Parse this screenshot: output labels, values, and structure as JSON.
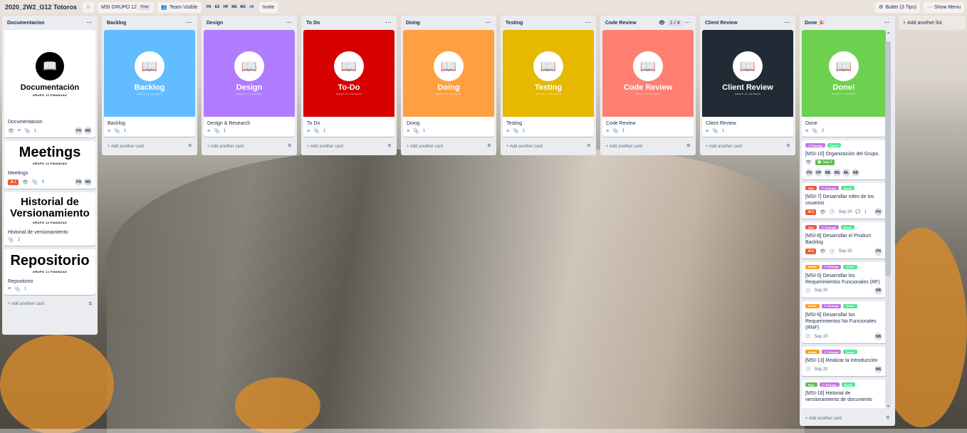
{
  "header": {
    "board_title": "2020_2W2_G12 Totoros",
    "star_icon": "star-icon",
    "team_label": "MSI GRUPO 12",
    "free_label": "Free",
    "visibility_label": "Team Visible",
    "members": [
      "FN",
      "ES",
      "HP",
      "ME",
      "MS"
    ],
    "more_members": "+5",
    "invite_label": "Invite",
    "butler_label": "Butler (3 Tips)",
    "show_menu_label": "Show Menu"
  },
  "lists": [
    {
      "title": "Documentacion"
    },
    {
      "title": "Backlog",
      "cover_title": "Backlog",
      "cover_color": "#61bdff",
      "card_title": "Backlog",
      "add": "Add another card"
    },
    {
      "title": "Design",
      "cover_title": "Design",
      "cover_color": "#b07cff",
      "card_title": "Design & Research",
      "add": "Add another card"
    },
    {
      "title": "To Do",
      "cover_title": "To-Do",
      "cover_color": "#d60000",
      "card_title": "To Do",
      "add": "Add another card"
    },
    {
      "title": "Doing",
      "cover_title": "Doing",
      "cover_color": "#ff9f40",
      "card_title": "Doing",
      "add": "Add another card"
    },
    {
      "title": "Testing",
      "cover_title": "Testing",
      "cover_color": "#e6b800",
      "card_title": "Testing",
      "add": "Add another card"
    },
    {
      "title": "Code Review",
      "limit": "1 / 4",
      "cover_title": "Code Review",
      "cover_color": "#ff7f73",
      "card_title": "Code Review",
      "add": "Add another card"
    },
    {
      "title": "Client Review",
      "cover_title": "Client Review",
      "cover_color": "#222b35",
      "card_title": "Client Review",
      "add": "Add another card"
    },
    {
      "title": "Done 🎉",
      "cover_title": "Done!",
      "cover_color": "#6dd04f",
      "card_title": "Done",
      "attach_count": "2",
      "add": "Add another card"
    }
  ],
  "doc": {
    "card1_cover": "Documentación",
    "card1_sub": "GRUPO 12 FINANZAS",
    "card1_title": "Documentacion",
    "card1_attach": "1",
    "card2_cover": "Meetings",
    "card2_sub": "GRUPO 12 FINANZAS",
    "card2_title": "Meetings",
    "card2_red": "1",
    "card2_attach": "5",
    "card3_cover_a": "Historial de",
    "card3_cover_b": "Versionamiento",
    "card3_sub": "GRUPO 12 FINANZAS",
    "card3_title": "Historial de versionamiento",
    "card3_attach": "2",
    "card4_cover": "Repositorio",
    "card4_sub": "GRUPO 12 FINANZAS",
    "card4_title": "Repositorio",
    "card4_attach": "1",
    "add": "Add another card",
    "members": [
      "FN",
      "MS"
    ]
  },
  "cover_sub": "GRUPO 12 FINANZAS",
  "done_cards": [
    {
      "labels": [
        {
          "t": "1° Entrega",
          "c": "#c377e0"
        },
        {
          "t": "Donel",
          "c": "#51e898"
        }
      ],
      "title": "[MSI-10] Organización del Grupo.",
      "due": "Sep 5",
      "members": [
        "FN",
        "HP",
        "ME",
        "MS",
        "ML",
        "NB"
      ]
    },
    {
      "labels": [
        {
          "t": "Alto",
          "c": "#eb5a46"
        },
        {
          "t": "1° Entrega",
          "c": "#c377e0"
        },
        {
          "t": "Donel",
          "c": "#51e898"
        }
      ],
      "title": "[MSI-7] Desarrollar roles de los usuarios",
      "red": "5",
      "date": "Sep 20",
      "comments": "1",
      "members": [
        "FN"
      ]
    },
    {
      "labels": [
        {
          "t": "Alto",
          "c": "#eb5a46"
        },
        {
          "t": "1° Entrega",
          "c": "#c377e0"
        },
        {
          "t": "Donel",
          "c": "#51e898"
        }
      ],
      "title": "[MSI-8] Desarrollar el Product Backlog",
      "red": "6",
      "date": "Sep 20",
      "members": [
        "FN"
      ]
    },
    {
      "labels": [
        {
          "t": "Medio",
          "c": "#ff9f1a"
        },
        {
          "t": "1° Entrega",
          "c": "#c377e0"
        },
        {
          "t": "Donel",
          "c": "#51e898"
        }
      ],
      "title": "[MSI-5] Desarrollar los Requerimientos Funcionales (RF)",
      "date": "Sep 20",
      "members": [
        "NB"
      ]
    },
    {
      "labels": [
        {
          "t": "Medio",
          "c": "#ff9f1a"
        },
        {
          "t": "1° Entrega",
          "c": "#c377e0"
        },
        {
          "t": "Donel",
          "c": "#51e898"
        }
      ],
      "title": "[MSI-6] Desarrollar los Requerimientos No Funcionales (RNF)",
      "date": "Sep 20",
      "members": [
        "NB"
      ]
    },
    {
      "labels": [
        {
          "t": "Medio",
          "c": "#ff9f1a"
        },
        {
          "t": "1° Entrega",
          "c": "#c377e0"
        },
        {
          "t": "Donel",
          "c": "#51e898"
        }
      ],
      "title": "[MSI-13] Realizar la Introducción",
      "date": "Sep 20",
      "members": [
        "MS"
      ]
    },
    {
      "labels": [
        {
          "t": "Bajo",
          "c": "#61bd4f"
        },
        {
          "t": "1° Entrega",
          "c": "#c377e0"
        },
        {
          "t": "Donel",
          "c": "#51e898"
        }
      ],
      "title": "[MSI-16] Historial de versionamiento de documento"
    }
  ],
  "add_list": "Add another list"
}
